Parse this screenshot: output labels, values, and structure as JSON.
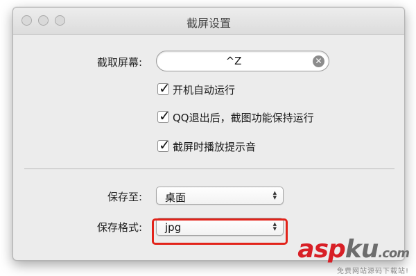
{
  "window": {
    "title": "截屏设置",
    "traffic_lights": [
      "close",
      "minimize",
      "zoom"
    ]
  },
  "capture": {
    "label": "截取屏幕:",
    "shortcut_value": "^Z",
    "clear_icon": "clear-circle-icon"
  },
  "options": [
    {
      "label": "开机自动运行",
      "checked": true
    },
    {
      "label": "QQ退出后，截图功能保持运行",
      "checked": true
    },
    {
      "label": "截屏时播放提示音",
      "checked": true
    }
  ],
  "save": {
    "location_label": "保存至:",
    "location_value": "桌面",
    "format_label": "保存格式:",
    "format_value": "jpg"
  },
  "watermark": {
    "logo_red": "asp",
    "logo_gray": "ku",
    "logo_tld": ".com",
    "subtitle": "免费网站源码下载站!"
  },
  "colors": {
    "window_bg": "#ececec",
    "highlight_box": "#e2231a",
    "watermark_red": "#d81f26"
  }
}
